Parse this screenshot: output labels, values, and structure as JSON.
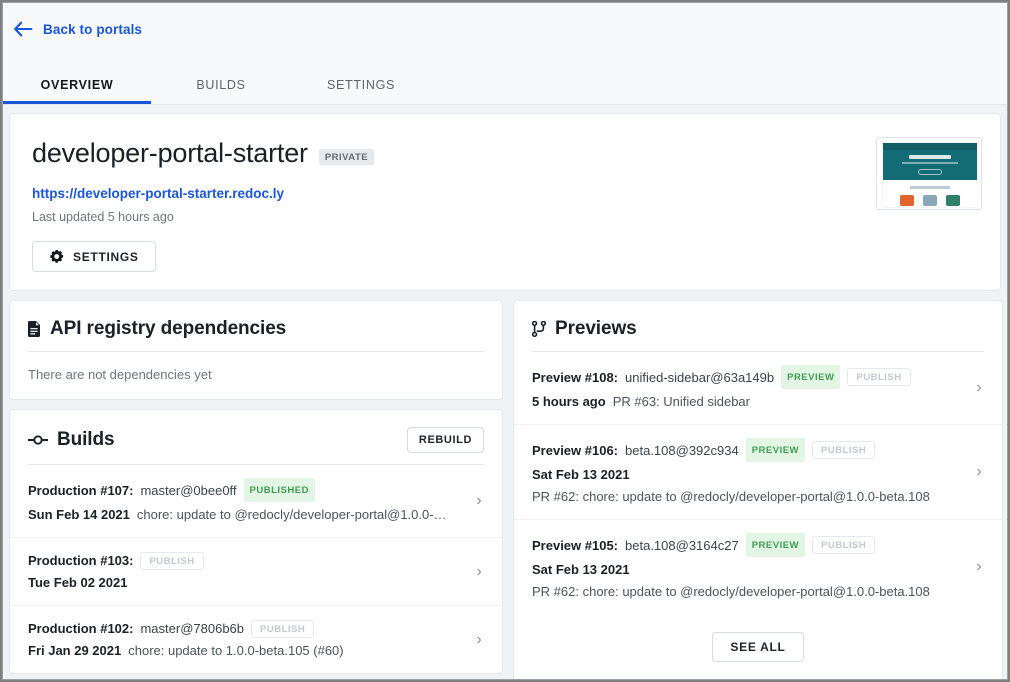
{
  "topbar": {
    "back_label": "Back to portals",
    "back_icon": "arrow-left-icon",
    "tabs": [
      {
        "label": "OVERVIEW",
        "active": true
      },
      {
        "label": "BUILDS",
        "active": false
      },
      {
        "label": "SETTINGS",
        "active": false
      }
    ]
  },
  "hero": {
    "title": "developer-portal-starter",
    "visibility_badge": "PRIVATE",
    "url": "https://developer-portal-starter.redoc.ly",
    "last_updated": "Last updated 5 hours ago",
    "settings_button": "SETTINGS",
    "settings_icon": "gear-icon",
    "thumbnail_heading": "Redocly training"
  },
  "dependencies": {
    "icon": "file-icon",
    "title": "API registry dependencies",
    "empty_text": "There are not dependencies yet"
  },
  "builds": {
    "icon": "git-commit-icon",
    "title": "Builds",
    "rebuild_button": "REBUILD",
    "items": [
      {
        "name": "Production #107:",
        "ref": "master@0bee0ff",
        "status_badge": "PUBLISHED",
        "publish_button": null,
        "date": "Sun Feb 14 2021",
        "message": "chore: update to @redocly/developer-portal@1.0.0-…",
        "chevron": "chevron-right-icon"
      },
      {
        "name": "Production #103:",
        "ref": "",
        "status_badge": null,
        "publish_button": "PUBLISH",
        "date": "Tue Feb 02 2021",
        "message": "",
        "chevron": "chevron-right-icon"
      },
      {
        "name": "Production #102:",
        "ref": "master@7806b6b",
        "status_badge": null,
        "publish_button": "PUBLISH",
        "date": "Fri Jan 29 2021",
        "message": "chore: update to 1.0.0-beta.105 (#60)",
        "chevron": "chevron-right-icon"
      }
    ]
  },
  "previews": {
    "icon": "git-branch-icon",
    "title": "Previews",
    "see_all_button": "SEE ALL",
    "items": [
      {
        "name": "Preview #108:",
        "ref": "unified-sidebar@63a149b",
        "status_badge": "PREVIEW",
        "publish_button": "PUBLISH",
        "date": "5 hours ago",
        "pr": "PR #63: Unified sidebar",
        "message": "",
        "chevron": "chevron-right-icon"
      },
      {
        "name": "Preview #106:",
        "ref": "beta.108@392c934",
        "status_badge": "PREVIEW",
        "publish_button": "PUBLISH",
        "date": "Sat Feb 13 2021",
        "pr": "",
        "message": "PR #62: chore: update to @redocly/developer-portal@1.0.0-beta.108",
        "chevron": "chevron-right-icon"
      },
      {
        "name": "Preview #105:",
        "ref": "beta.108@3164c27",
        "status_badge": "PREVIEW",
        "publish_button": "PUBLISH",
        "date": "Sat Feb 13 2021",
        "pr": "",
        "message": "PR #62: chore: update to @redocly/developer-portal@1.0.0-beta.108",
        "chevron": "chevron-right-icon"
      }
    ]
  },
  "colors": {
    "accent_blue": "#1a56db",
    "page_bg": "#eff3f5",
    "card_bg": "#ffffff",
    "badge_green_bg": "#e3f6e6",
    "badge_green_text": "#3f9d52",
    "thumb_teal": "#136c75"
  }
}
